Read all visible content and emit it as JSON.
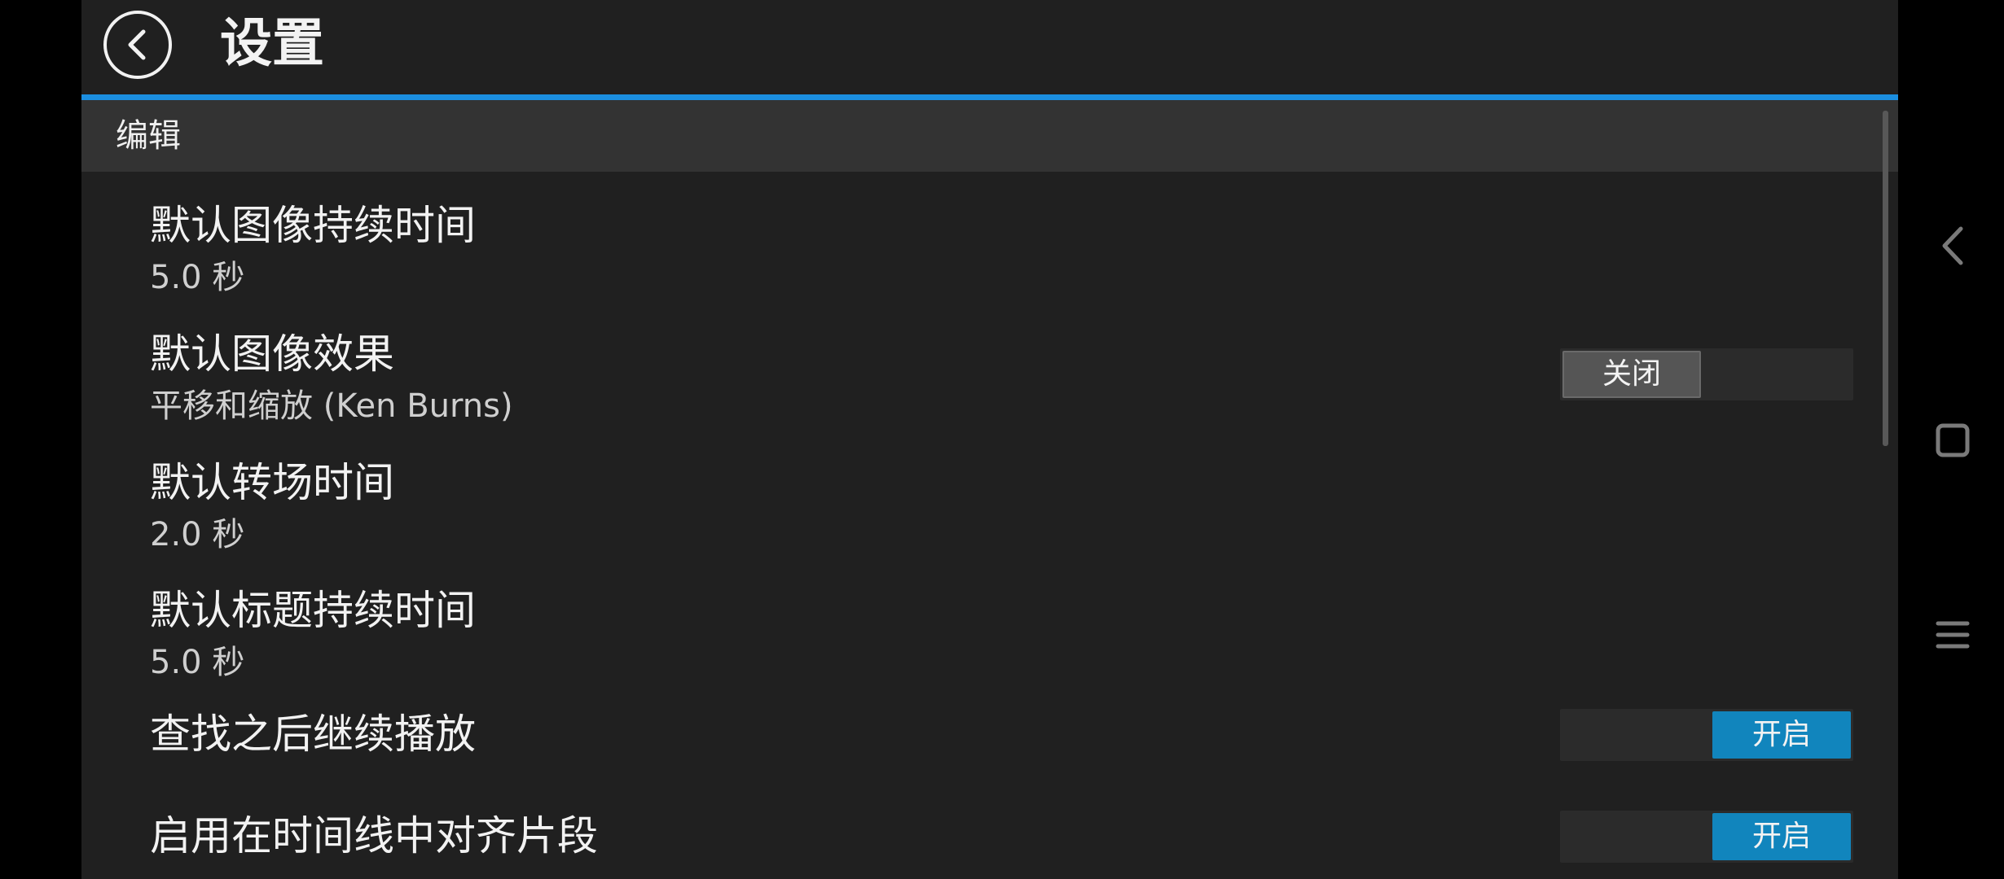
{
  "header": {
    "title": "设置"
  },
  "section": {
    "title": "编辑"
  },
  "settings": [
    {
      "title": "默认图像持续时间",
      "value": "5.0  秒"
    },
    {
      "title": "默认图像效果",
      "value": "平移和缩放 (Ken Burns)",
      "toggle_label": "关闭"
    },
    {
      "title": "默认转场时间",
      "value": "2.0  秒"
    },
    {
      "title": "默认标题持续时间",
      "value": "5.0  秒"
    },
    {
      "title": "查找之后继续播放",
      "toggle_label": "开启"
    },
    {
      "title": "启用在时间线中对齐片段",
      "toggle_label": "开启"
    }
  ],
  "colors": {
    "accent": "#1b8ee0",
    "toggle_on": "#1185bd",
    "background": "#202020"
  },
  "icons": {
    "back": "chevron-left-icon",
    "system_back": "chevron-left-icon",
    "system_home": "square-icon",
    "system_menu": "menu-icon"
  }
}
